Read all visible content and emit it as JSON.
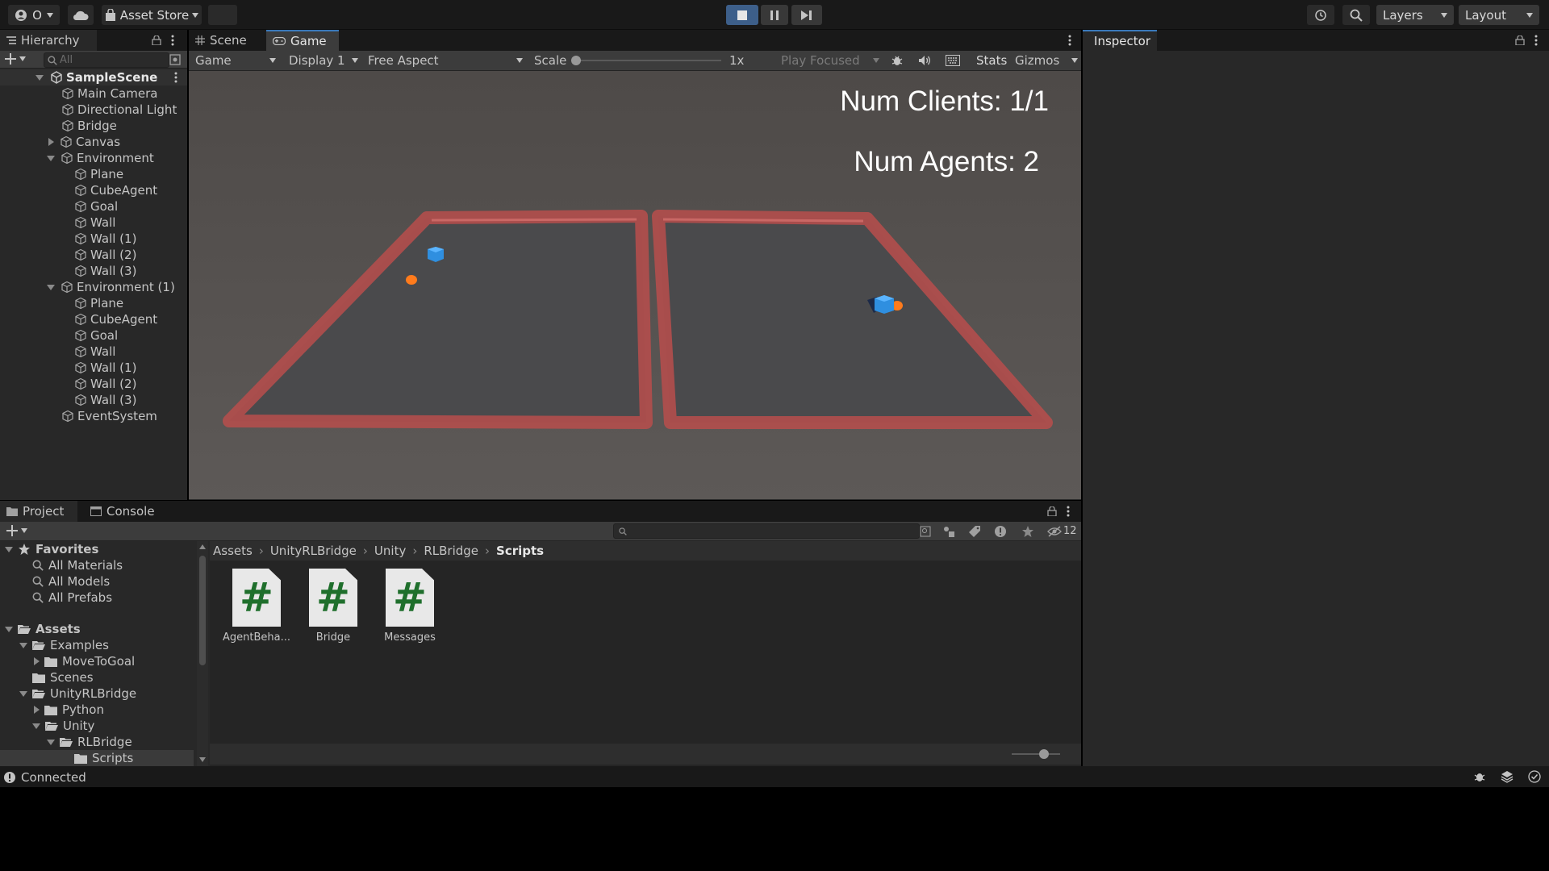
{
  "toolbar": {
    "account_label": "O",
    "asset_store_label": "Asset Store",
    "layers_label": "Layers",
    "layout_label": "Layout"
  },
  "hierarchy": {
    "tab_label": "Hierarchy",
    "search_placeholder": "All",
    "scene_name": "SampleScene",
    "items": [
      {
        "label": "Main Camera"
      },
      {
        "label": "Directional Light"
      },
      {
        "label": "Bridge"
      },
      {
        "label": "Canvas"
      },
      {
        "label": "Environment"
      },
      {
        "label": "Plane"
      },
      {
        "label": "CubeAgent"
      },
      {
        "label": "Goal"
      },
      {
        "label": "Wall"
      },
      {
        "label": "Wall (1)"
      },
      {
        "label": "Wall (2)"
      },
      {
        "label": "Wall (3)"
      },
      {
        "label": "Environment (1)"
      },
      {
        "label": "Plane"
      },
      {
        "label": "CubeAgent"
      },
      {
        "label": "Goal"
      },
      {
        "label": "Wall"
      },
      {
        "label": "Wall (1)"
      },
      {
        "label": "Wall (2)"
      },
      {
        "label": "Wall (3)"
      },
      {
        "label": "EventSystem"
      }
    ]
  },
  "game": {
    "scene_tab": "Scene",
    "game_tab": "Game",
    "mode_select": "Game",
    "display_select": "Display 1",
    "aspect_select": "Free Aspect",
    "scale_label": "Scale",
    "scale_value": "1x",
    "play_focused": "Play Focused",
    "stats_label": "Stats",
    "gizmos_label": "Gizmos",
    "hud_clients": "Num Clients: 1/1",
    "hud_agents": "Num Agents: 2"
  },
  "inspector": {
    "tab_label": "Inspector"
  },
  "project": {
    "project_tab": "Project",
    "console_tab": "Console",
    "hidden_count": "12",
    "favorites_label": "Favorites",
    "favorites": [
      {
        "label": "All Materials"
      },
      {
        "label": "All Models"
      },
      {
        "label": "All Prefabs"
      }
    ],
    "assets_label": "Assets",
    "tree": [
      {
        "label": "Examples"
      },
      {
        "label": "MoveToGoal"
      },
      {
        "label": "Scenes"
      },
      {
        "label": "UnityRLBridge"
      },
      {
        "label": "Python"
      },
      {
        "label": "Unity"
      },
      {
        "label": "RLBridge"
      },
      {
        "label": "Scripts"
      }
    ],
    "breadcrumb": [
      "Assets",
      "UnityRLBridge",
      "Unity",
      "RLBridge",
      "Scripts"
    ],
    "files": [
      {
        "label": "AgentBeha...",
        "icon": "csharp-script-icon"
      },
      {
        "label": "Bridge",
        "icon": "csharp-script-icon"
      },
      {
        "label": "Messages",
        "icon": "csharp-script-icon"
      }
    ]
  },
  "status": {
    "text": "Connected"
  },
  "colors": {
    "accent": "#3a79bb",
    "play_active": "#3d5f8a",
    "wall_red": "#c0504d",
    "agent_blue": "#2f8fe0",
    "goal_orange": "#ff7b1c"
  }
}
